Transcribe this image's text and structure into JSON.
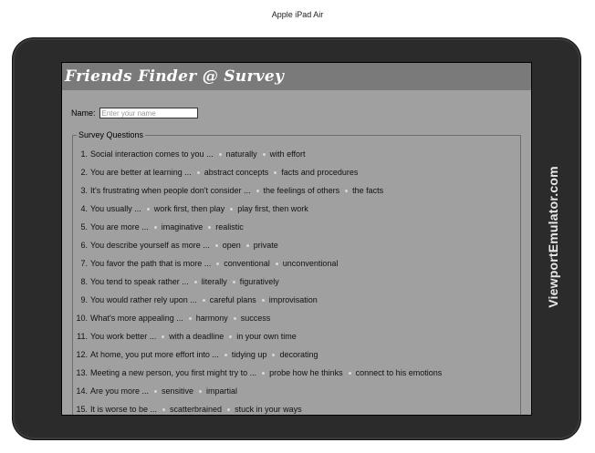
{
  "emulator": {
    "device_label": "Apple iPad Air",
    "brand": "ViewportEmulator.com"
  },
  "app": {
    "title": "Friends Finder @ Survey",
    "name_label": "Name:",
    "name_placeholder": "Enter your name",
    "name_value": "",
    "survey_legend": "Survey Questions",
    "questions": [
      {
        "num": "1.",
        "text": "Social interaction comes to you ...",
        "options": [
          "naturally",
          "with effort"
        ]
      },
      {
        "num": "2.",
        "text": "You are better at learning ...",
        "options": [
          "abstract concepts",
          "facts and procedures"
        ]
      },
      {
        "num": "3.",
        "text": "It's frustrating when people don't consider ...",
        "options": [
          "the feelings of others",
          "the facts"
        ]
      },
      {
        "num": "4.",
        "text": "You usually ...",
        "options": [
          "work first, then play",
          "play first, then work"
        ]
      },
      {
        "num": "5.",
        "text": "You are more ...",
        "options": [
          "imaginative",
          "realistic"
        ]
      },
      {
        "num": "6.",
        "text": "You describe yourself as more ...",
        "options": [
          "open",
          "private"
        ]
      },
      {
        "num": "7.",
        "text": "You favor the path that is more ...",
        "options": [
          "conventional",
          "unconventional"
        ]
      },
      {
        "num": "8.",
        "text": "You tend to speak rather ...",
        "options": [
          "literally",
          "figuratively"
        ]
      },
      {
        "num": "9.",
        "text": "You would rather rely upon ...",
        "options": [
          "careful plans",
          "improvisation"
        ]
      },
      {
        "num": "10.",
        "text": "What's more appealing ...",
        "options": [
          "harmony",
          "success"
        ]
      },
      {
        "num": "11.",
        "text": "You work better ...",
        "options": [
          "with a deadline",
          "in your own time"
        ]
      },
      {
        "num": "12.",
        "text": "At home, you put more effort into ...",
        "options": [
          "tidying up",
          "decorating"
        ]
      },
      {
        "num": "13.",
        "text": "Meeting a new person, you first might try to ...",
        "options": [
          "probe how he thinks",
          "connect to his emotions"
        ]
      },
      {
        "num": "14.",
        "text": "Are you more ...",
        "options": [
          "sensitive",
          "impartial"
        ]
      },
      {
        "num": "15.",
        "text": "It is worse to be ...",
        "options": [
          "scatterbrained",
          "stuck in your ways"
        ]
      }
    ]
  }
}
